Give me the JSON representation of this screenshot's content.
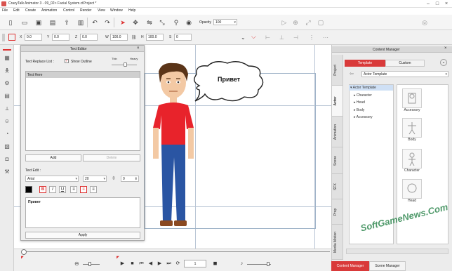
{
  "window": {
    "title": "CrazyTalk Animator 3 - 09_02> Facial System.ctProject *"
  },
  "menu": [
    "File",
    "Edit",
    "Create",
    "Animation",
    "Control",
    "Render",
    "View",
    "Window",
    "Help"
  ],
  "toolbar": {
    "opacity_label": "Opacity",
    "opacity_value": "100"
  },
  "transform": {
    "x_label": "X",
    "x_value": "0.0",
    "y_label": "Y",
    "y_value": "0.0",
    "angle_label": "Z",
    "angle_value": "0.0",
    "w_label": "W",
    "w_value": "100.0",
    "h_label": "H",
    "h_value": "100.0",
    "s_label": "S",
    "s_value": "0"
  },
  "text_editor": {
    "title": "Text Editor",
    "replace_list_label": "Text Replace List :",
    "show_outline_label": "Show Outline",
    "thin_label": "Thin",
    "heavy_label": "Heavy",
    "list_item": "Text Here",
    "add_button": "Add",
    "delete_button": "Delete",
    "text_edit_label": "Text Edit :",
    "font_value": "Arial",
    "size_value": "20",
    "spacing_value": "0",
    "bold": "B",
    "italic": "I",
    "underline": "U",
    "text_value": "Привет",
    "apply_button": "Apply"
  },
  "stage": {
    "bubble_text": "Привет"
  },
  "content_manager": {
    "title": "Content Manager",
    "tab_template": "Template",
    "tab_custom": "Custom",
    "path": "Actor Template",
    "side_tabs": [
      "Project",
      "Actor",
      "Animation",
      "Scene",
      "SFX",
      "Prop",
      "Media Motion"
    ],
    "tree": [
      "Actor Template",
      "Character",
      "Head",
      "Body",
      "Accessory"
    ],
    "thumbs": [
      "Accessory",
      "Body",
      "Character",
      "Head"
    ],
    "bottom_tabs": [
      "Content Manager",
      "Scene Manager"
    ]
  },
  "timeline": {
    "frame_value": "1"
  },
  "watermark": "SoftGameNews.Com",
  "colors": {
    "accent": "#e03030",
    "selected_tab": "#d93a3a",
    "tree_highlight": "#cfe0f5"
  }
}
